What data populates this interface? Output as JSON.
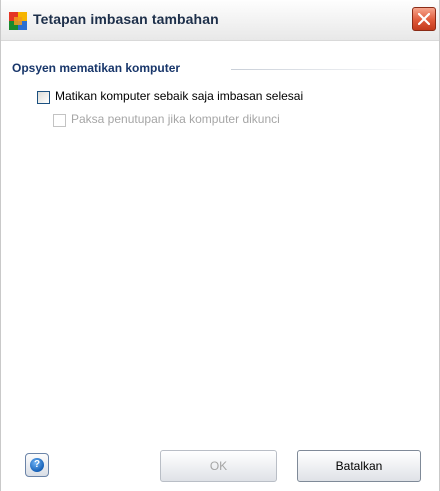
{
  "window": {
    "title": "Tetapan imbasan tambahan",
    "icon": "avg-logo-icon",
    "close_icon": "close-icon"
  },
  "section": {
    "title": "Opsyen mematikan komputer"
  },
  "options": [
    {
      "label": "Matikan komputer sebaik saja imbasan selesai",
      "checked": false,
      "enabled": true
    },
    {
      "label": "Paksa penutupan jika komputer dikunci",
      "checked": false,
      "enabled": false
    }
  ],
  "footer": {
    "help_icon": "help-icon",
    "help_glyph": "?",
    "ok_label": "OK",
    "ok_enabled": false,
    "cancel_label": "Batalkan"
  },
  "colors": {
    "title_text": "#1d2f4a",
    "section_title": "#18366a",
    "close_button": "#e05a3a",
    "disabled_text": "#a6a6a6"
  }
}
